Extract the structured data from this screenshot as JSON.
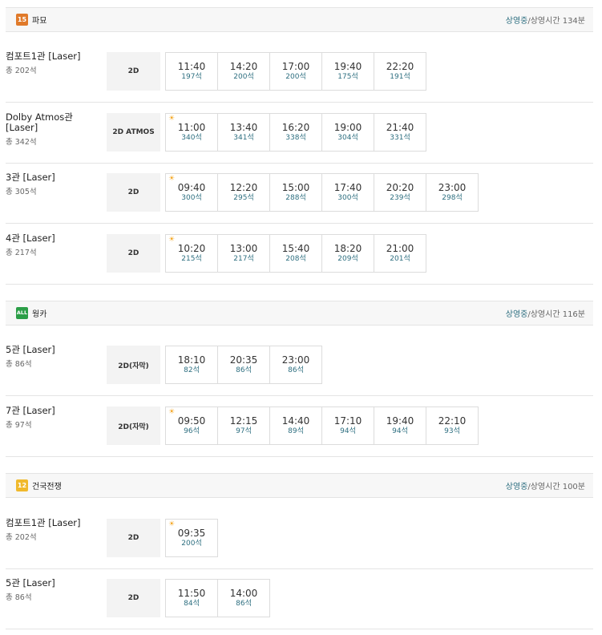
{
  "movies": [
    {
      "rating": "15",
      "rating_class": "r15",
      "title": "파묘",
      "status": "상영중",
      "runtime": "/상영시간 134분",
      "halls": [
        {
          "name": "컴포트1관 [Laser]",
          "seats": "총 202석",
          "format": "2D",
          "times": [
            {
              "time": "11:40",
              "seats": "197석",
              "morning": false
            },
            {
              "time": "14:20",
              "seats": "200석",
              "morning": false
            },
            {
              "time": "17:00",
              "seats": "200석",
              "morning": false
            },
            {
              "time": "19:40",
              "seats": "175석",
              "morning": false
            },
            {
              "time": "22:20",
              "seats": "191석",
              "morning": false
            }
          ]
        },
        {
          "name": "Dolby Atmos관 [Laser]",
          "seats": "총 342석",
          "format": "2D ATMOS",
          "times": [
            {
              "time": "11:00",
              "seats": "340석",
              "morning": true
            },
            {
              "time": "13:40",
              "seats": "341석",
              "morning": false
            },
            {
              "time": "16:20",
              "seats": "338석",
              "morning": false
            },
            {
              "time": "19:00",
              "seats": "304석",
              "morning": false
            },
            {
              "time": "21:40",
              "seats": "331석",
              "morning": false
            }
          ]
        },
        {
          "name": "3관 [Laser]",
          "seats": "총 305석",
          "format": "2D",
          "times": [
            {
              "time": "09:40",
              "seats": "300석",
              "morning": true
            },
            {
              "time": "12:20",
              "seats": "295석",
              "morning": false
            },
            {
              "time": "15:00",
              "seats": "288석",
              "morning": false
            },
            {
              "time": "17:40",
              "seats": "300석",
              "morning": false
            },
            {
              "time": "20:20",
              "seats": "239석",
              "morning": false
            },
            {
              "time": "23:00",
              "seats": "298석",
              "morning": false
            }
          ]
        },
        {
          "name": "4관 [Laser]",
          "seats": "총 217석",
          "format": "2D",
          "times": [
            {
              "time": "10:20",
              "seats": "215석",
              "morning": true
            },
            {
              "time": "13:00",
              "seats": "217석",
              "morning": false
            },
            {
              "time": "15:40",
              "seats": "208석",
              "morning": false
            },
            {
              "time": "18:20",
              "seats": "209석",
              "morning": false
            },
            {
              "time": "21:00",
              "seats": "201석",
              "morning": false
            }
          ]
        }
      ]
    },
    {
      "rating": "ALL",
      "rating_class": "rall",
      "title": "웡카",
      "status": "상영중",
      "runtime": "/상영시간 116분",
      "halls": [
        {
          "name": "5관 [Laser]",
          "seats": "총 86석",
          "format": "2D(자막)",
          "times": [
            {
              "time": "18:10",
              "seats": "82석",
              "morning": false
            },
            {
              "time": "20:35",
              "seats": "86석",
              "morning": false
            },
            {
              "time": "23:00",
              "seats": "86석",
              "morning": false
            }
          ]
        },
        {
          "name": "7관 [Laser]",
          "seats": "총 97석",
          "format": "2D(자막)",
          "times": [
            {
              "time": "09:50",
              "seats": "96석",
              "morning": true
            },
            {
              "time": "12:15",
              "seats": "97석",
              "morning": false
            },
            {
              "time": "14:40",
              "seats": "89석",
              "morning": false
            },
            {
              "time": "17:10",
              "seats": "94석",
              "morning": false
            },
            {
              "time": "19:40",
              "seats": "94석",
              "morning": false
            },
            {
              "time": "22:10",
              "seats": "93석",
              "morning": false
            }
          ]
        }
      ]
    },
    {
      "rating": "12",
      "rating_class": "r12",
      "title": "건국전쟁",
      "status": "상영중",
      "runtime": "/상영시간 100분",
      "halls": [
        {
          "name": "컴포트1관 [Laser]",
          "seats": "총 202석",
          "format": "2D",
          "times": [
            {
              "time": "09:35",
              "seats": "200석",
              "morning": true
            }
          ]
        },
        {
          "name": "5관 [Laser]",
          "seats": "총 86석",
          "format": "2D",
          "times": [
            {
              "time": "11:50",
              "seats": "84석",
              "morning": false
            },
            {
              "time": "14:00",
              "seats": "86석",
              "morning": false
            }
          ]
        }
      ]
    }
  ],
  "icons": {
    "morning": "sun-icon"
  }
}
